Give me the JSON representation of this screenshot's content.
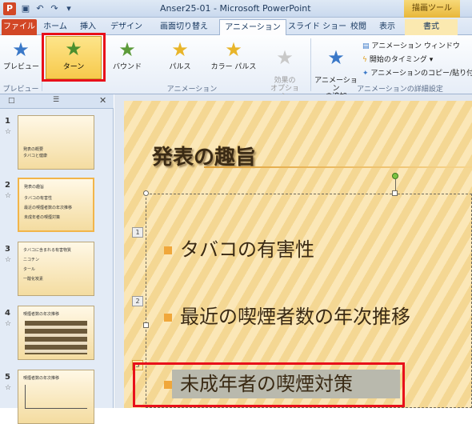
{
  "window": {
    "title": "Anser25-01 - Microsoft PowerPoint",
    "context_tab_header": "描画ツール"
  },
  "tabs": [
    "ファイル",
    "ホーム",
    "挿入",
    "デザイン",
    "画面切り替え",
    "アニメーション",
    "スライド ショー",
    "校閲",
    "表示",
    "書式"
  ],
  "ribbon": {
    "preview": {
      "label": "プレビュー",
      "group": "プレビュー"
    },
    "animations": {
      "items": [
        "ターン",
        "バウンド",
        "パルス",
        "カラー パルス"
      ],
      "effect_options": "効果の\nオプション",
      "group": "アニメーション"
    },
    "advanced": {
      "add_animation": "アニメーション\nの追加",
      "pane": "アニメーション ウィンドウ",
      "trigger": "開始のタイミング",
      "painter": "アニメーションのコピー/貼り付け",
      "group": "アニメーションの詳細設定"
    }
  },
  "thumbnails": [
    {
      "num": "1",
      "lines": [
        "発表の概要",
        "タバコと健康"
      ]
    },
    {
      "num": "2",
      "lines": [
        "発表の趣旨",
        "タバコの有害性",
        "最近の喫煙者数の年次推移",
        "未成年者の喫煙対策"
      ]
    },
    {
      "num": "3",
      "lines": [
        "タバコに含まれる有害物質",
        "ニコチン",
        "タール",
        "一酸化炭素"
      ]
    },
    {
      "num": "4",
      "lines": [
        "喫煙者数の年次推移"
      ]
    },
    {
      "num": "5",
      "lines": [
        "喫煙者数の年次推移"
      ]
    }
  ],
  "slide": {
    "title": "発表の趣旨",
    "bullets": [
      {
        "tag": "1",
        "text": "タバコの有害性"
      },
      {
        "tag": "2",
        "text": "最近の喫煙者数の年次推移"
      },
      {
        "tag": "3",
        "text": "未成年者の喫煙対策"
      }
    ]
  }
}
